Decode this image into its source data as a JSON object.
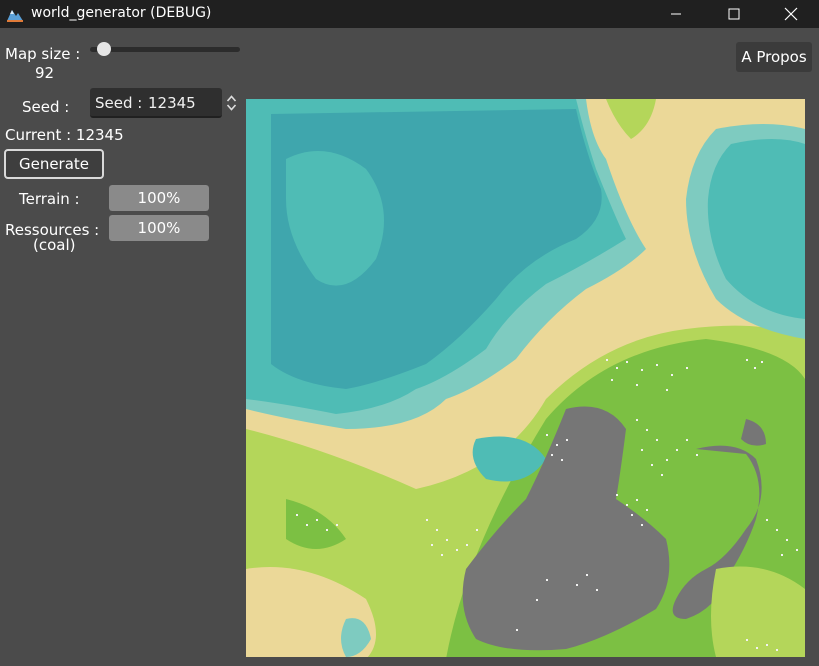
{
  "window": {
    "title": "world_generator (DEBUG)",
    "app_icon": "godot-engine-icon",
    "controls": [
      "minimize-icon",
      "maximize-icon",
      "close-icon"
    ]
  },
  "sidebar": {
    "map_size_label": "Map size :",
    "map_size_value": "92",
    "map_size_slider_fraction": 0.05,
    "seed_label": "Seed :",
    "seed_prefix": "Seed :",
    "seed_value": "12345",
    "current_label": "Current : 12345",
    "generate_label": "Generate",
    "terrain_label": "Terrain :",
    "terrain_progress_text": "100%",
    "terrain_progress_fraction": 1.0,
    "resources_label": "Ressources :",
    "resources_sublabel": "(coal)",
    "resources_progress_text": "100%",
    "resources_progress_fraction": 1.0
  },
  "header": {
    "apropos_label": "A Propos"
  },
  "map": {
    "colors": {
      "deep_water": "#3fa6ad",
      "water": "#4fbcb5",
      "shallow": "#7ecbc0",
      "sand": "#ebd898",
      "light_grass": "#b4d65a",
      "grass": "#7cc043",
      "rock": "#767676",
      "ui_background": "#4b4b4b",
      "titlebar": "#202020"
    }
  }
}
